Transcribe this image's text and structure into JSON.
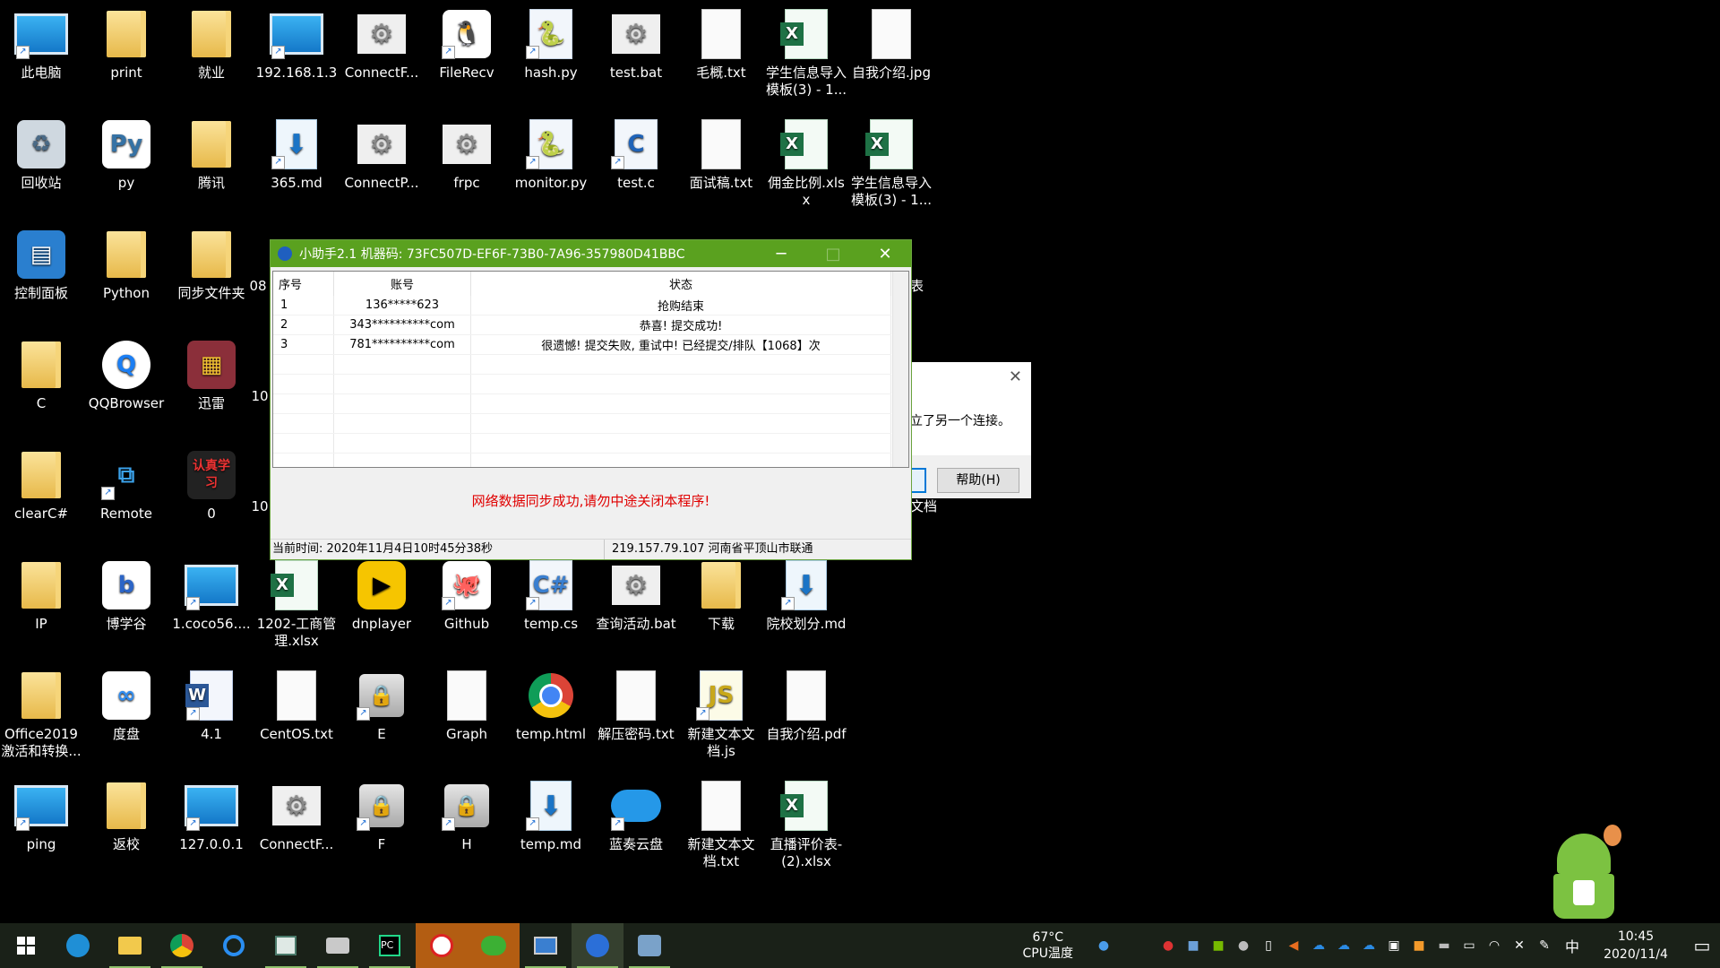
{
  "desktop": {
    "icons": [
      {
        "label": "此电脑",
        "kind": "pc"
      },
      {
        "label": "print",
        "kind": "folder"
      },
      {
        "label": "就业",
        "kind": "folder"
      },
      {
        "label": "192.168.1.3",
        "kind": "pc"
      },
      {
        "label": "ConnectF...",
        "kind": "gear"
      },
      {
        "label": "FileRecv",
        "kind": "qq"
      },
      {
        "label": "hash.py",
        "kind": "py"
      },
      {
        "label": "test.bat",
        "kind": "gear"
      },
      {
        "label": "毛概.txt",
        "kind": "doc"
      },
      {
        "label": "学生信息导入模板(3) - 1...",
        "kind": "xls"
      },
      {
        "label": "自我介绍.jpg",
        "kind": "doc"
      },
      {
        "label": "回收站",
        "kind": "bin"
      },
      {
        "label": "py",
        "kind": "python"
      },
      {
        "label": "腾讯",
        "kind": "folder"
      },
      {
        "label": "365.md",
        "kind": "dl"
      },
      {
        "label": "ConnectP...",
        "kind": "gear"
      },
      {
        "label": "frpc",
        "kind": "gear"
      },
      {
        "label": "monitor.py",
        "kind": "py"
      },
      {
        "label": "test.c",
        "kind": "c"
      },
      {
        "label": "面试稿.txt",
        "kind": "doc"
      },
      {
        "label": "佣金比例.xlsx",
        "kind": "xls"
      },
      {
        "label": "学生信息导入模板(3) - 1...",
        "kind": "xls"
      },
      {
        "label": "控制面板",
        "kind": "ctrl"
      },
      {
        "label": "Python",
        "kind": "folder"
      },
      {
        "label": "同步文件夹",
        "kind": "folder"
      },
      {
        "label": "C",
        "kind": "folder"
      },
      {
        "label": "QQBrowser",
        "kind": "qqb"
      },
      {
        "label": "迅雷",
        "kind": "rar"
      },
      {
        "label": "clearC#",
        "kind": "folder"
      },
      {
        "label": "Remote",
        "kind": "remote"
      },
      {
        "label": "0",
        "kind": "img0"
      },
      {
        "label": "IP",
        "kind": "folder"
      },
      {
        "label": "博学谷",
        "kind": "bxg"
      },
      {
        "label": "1.coco56....",
        "kind": "pc"
      },
      {
        "label": "1202-工商管理.xlsx",
        "kind": "xls"
      },
      {
        "label": "dnplayer",
        "kind": "dn"
      },
      {
        "label": "Github",
        "kind": "gh"
      },
      {
        "label": "temp.cs",
        "kind": "cs"
      },
      {
        "label": "查询活动.bat",
        "kind": "gear"
      },
      {
        "label": "下载",
        "kind": "folder"
      },
      {
        "label": "院校划分.md",
        "kind": "dl"
      },
      {
        "label": "Office2019激活和转换...",
        "kind": "folder"
      },
      {
        "label": "度盘",
        "kind": "baidu"
      },
      {
        "label": "4.1",
        "kind": "word"
      },
      {
        "label": "CentOS.txt",
        "kind": "doc"
      },
      {
        "label": "E",
        "kind": "drive"
      },
      {
        "label": "Graph",
        "kind": "doc"
      },
      {
        "label": "temp.html",
        "kind": "chrome"
      },
      {
        "label": "解压密码.txt",
        "kind": "doc"
      },
      {
        "label": "新建文本文档.js",
        "kind": "js"
      },
      {
        "label": "自我介绍.pdf",
        "kind": "doc"
      },
      {
        "label": "ping",
        "kind": "pc"
      },
      {
        "label": "返校",
        "kind": "folder"
      },
      {
        "label": "127.0.0.1",
        "kind": "pc"
      },
      {
        "label": "ConnectF...",
        "kind": "gear"
      },
      {
        "label": "F",
        "kind": "drive"
      },
      {
        "label": "H",
        "kind": "drive"
      },
      {
        "label": "temp.md",
        "kind": "dl"
      },
      {
        "label": "蓝奏云盘",
        "kind": "cloud"
      },
      {
        "label": "新建文本文档.txt",
        "kind": "doc"
      },
      {
        "label": "直播评价表-(2).xlsx",
        "kind": "xls"
      }
    ],
    "partial_labels": {
      "row3": "08",
      "row4": "10",
      "row5": "10",
      "right3": "表",
      "right5": "文档"
    }
  },
  "helper_window": {
    "title": "小助手2.1  机器码: 73FC507D-EF6F-73B0-7A96-357980D41BBC",
    "minimize": "─",
    "maximize": "□",
    "close": "✕",
    "columns": [
      "序号",
      "账号",
      "状态"
    ],
    "rows": [
      {
        "seq": "1",
        "account": "136*****623",
        "status": "抢购结束"
      },
      {
        "seq": "2",
        "account": "343**********com",
        "status": "恭喜! 提交成功!"
      },
      {
        "seq": "3",
        "account": "781**********com",
        "status": "很遗憾! 提交失败, 重试中! 已经提交/排队【1068】次"
      }
    ],
    "message": "网络数据同步成功,请勿中途关闭本程序!",
    "status_time": "当前时间: 2020年11月4日10时45分38秒",
    "status_ip": "219.157.79.107  河南省平顶山市联通"
  },
  "background_dialog": {
    "close": "✕",
    "message": "立了另一个连接。",
    "help_button": "帮助(H)"
  },
  "taskbar": {
    "start_icon": "windows-icon",
    "apps": [
      "edge",
      "explorer",
      "chrome",
      "qqbrowser",
      "app-window",
      "app-network",
      "pycharm",
      "qq-red",
      "wechat",
      "remote-desktop",
      "helper",
      "tool"
    ],
    "temperature": "67°C",
    "temp_label": "CPU温度",
    "ime": "中",
    "time": "10:45",
    "date": "2020/11/4"
  },
  "colors": {
    "title_green": "#5aa11f",
    "warning_red": "#e00000",
    "taskbar": "#1a2118"
  }
}
